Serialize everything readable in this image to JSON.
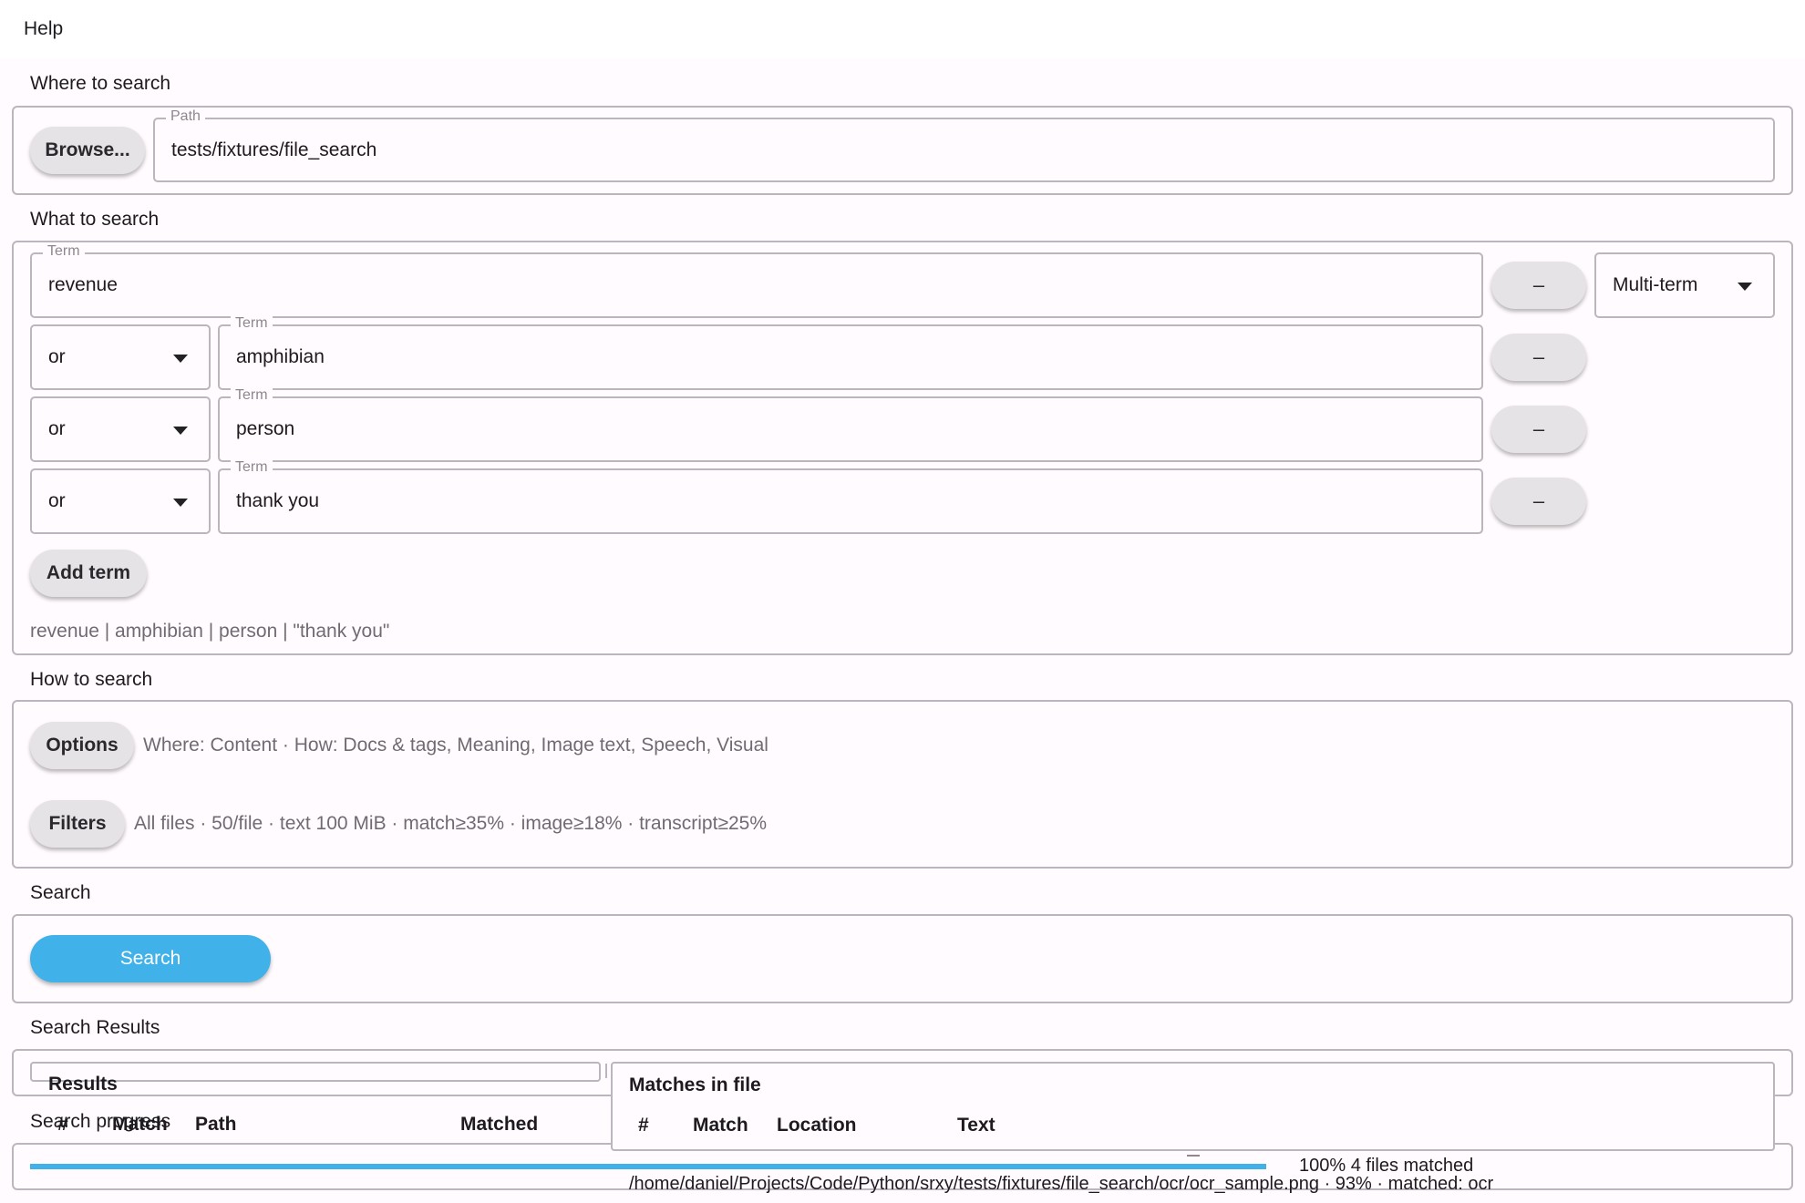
{
  "menu": {
    "help": "Help"
  },
  "where": {
    "section_label": "Where to search",
    "browse_label": "Browse...",
    "path_label": "Path",
    "path_value": "tests/fixtures/file_search"
  },
  "what": {
    "section_label": "What to search",
    "first_term": {
      "label": "Term",
      "value": "revenue"
    },
    "mode_selected": "Multi-term",
    "terms": [
      {
        "operator": "or",
        "label": "Term",
        "value": "amphibian"
      },
      {
        "operator": "or",
        "label": "Term",
        "value": "person"
      },
      {
        "operator": "or",
        "label": "Term",
        "value": "thank you"
      }
    ],
    "remove_label": "–",
    "add_term_label": "Add term",
    "query_preview": "revenue | amphibian | person | \"thank you\""
  },
  "how": {
    "section_label": "How to search",
    "options_label": "Options",
    "options_summary": "Where: Content · How: Docs & tags, Meaning, Image text, Speech, Visual",
    "filters_label": "Filters",
    "filters_summary": "All files · 50/file · text 100 MiB · match≥35% · image≥18% · transcript≥25%"
  },
  "search": {
    "section_label": "Search",
    "button_label": "Search",
    "accent_color": "#41b1ea"
  },
  "results": {
    "section_label": "Search Results",
    "results_title": "Results",
    "results_columns": [
      "#",
      "Match",
      "Path",
      "Matched"
    ],
    "matches_title": "Matches in file",
    "matches_columns": [
      "#",
      "Match",
      "Location",
      "Text"
    ]
  },
  "progress": {
    "section_label": "Search progress",
    "fraction": 1.0,
    "status": "100%  4 files matched",
    "current_file": "/home/daniel/Projects/Code/Python/srxy/tests/fixtures/file_search/ocr/ocr_sample.png  ·  93%  ·  matched: ocr"
  }
}
